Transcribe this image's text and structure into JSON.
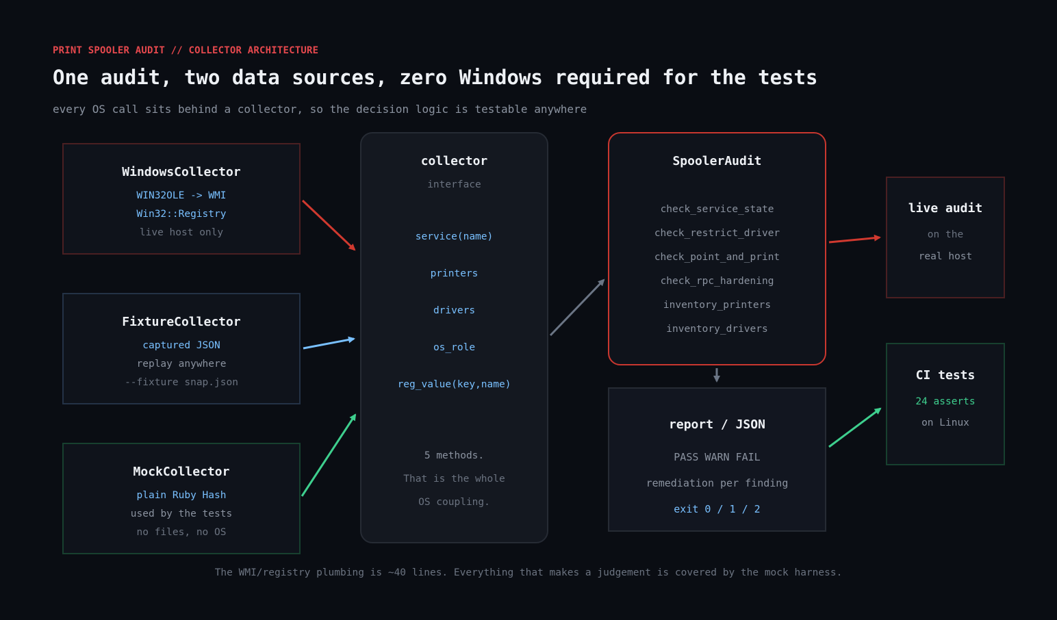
{
  "header": {
    "eyebrow": "PRINT SPOOLER AUDIT // COLLECTOR ARCHITECTURE",
    "title": "One audit, two data sources, zero Windows required for the tests",
    "subtitle": "every OS call sits behind a collector, so the decision logic is testable anywhere"
  },
  "sources": {
    "windows": {
      "title": "WindowsCollector",
      "line1": "WIN32OLE -> WMI",
      "line2": "Win32::Registry",
      "line3": "live host only"
    },
    "fixture": {
      "title": "FixtureCollector",
      "line1": "captured JSON",
      "line2": "replay anywhere",
      "line3": "--fixture snap.json"
    },
    "mock": {
      "title": "MockCollector",
      "line1": "plain Ruby Hash",
      "line2": "used by the tests",
      "line3": "no files, no OS"
    }
  },
  "collector": {
    "title": "collector",
    "subtitle": "interface",
    "methods": [
      "service(name)",
      "printers",
      "drivers",
      "os_role",
      "reg_value(key,name)"
    ],
    "note1": "5 methods.",
    "note2": "That is the whole",
    "note3": "OS coupling."
  },
  "audit": {
    "title": "SpoolerAudit",
    "checks": [
      "check_service_state",
      "check_restrict_driver",
      "check_point_and_print",
      "check_rpc_hardening",
      "inventory_printers",
      "inventory_drivers"
    ]
  },
  "report": {
    "title": "report / JSON",
    "line1": "PASS WARN FAIL",
    "line2": "remediation per finding",
    "line3": "exit 0 / 1 / 2"
  },
  "live": {
    "title": "live audit",
    "line1": "on the",
    "line2": "real host"
  },
  "ci": {
    "title": "CI tests",
    "line1": "24 asserts",
    "line2": "on Linux"
  },
  "footer": "The WMI/registry plumbing is ~40 lines. Everything that makes a judgement is covered by the mock harness.",
  "colors": {
    "red": "#e5484d",
    "blue": "#79c0ff",
    "green": "#3ecf8e",
    "grey": "#6b7585",
    "background": "#0a0d13"
  }
}
